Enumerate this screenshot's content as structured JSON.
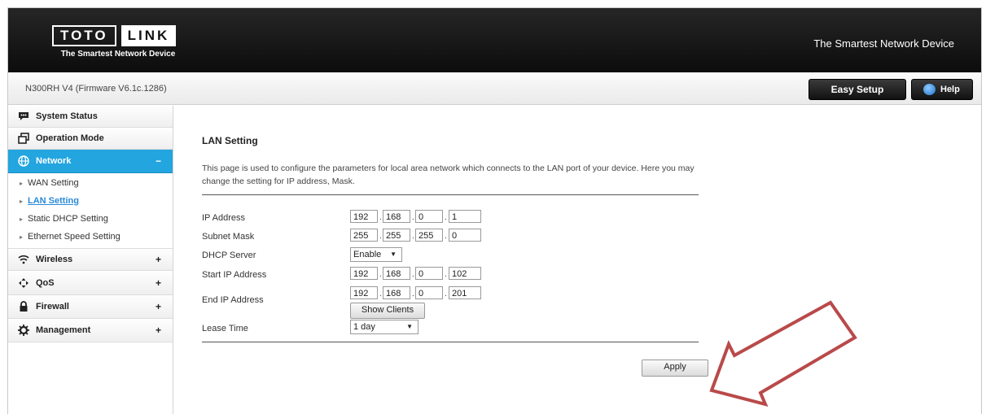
{
  "header": {
    "logo_word1": "TOTO",
    "logo_word2": "LINK",
    "logo_tagline": "The Smartest Network Device",
    "slogan": "The Smartest Network Device"
  },
  "subheader": {
    "model": "N300RH V4 (Firmware V6.1c.1286)",
    "easy_setup": "Easy Setup",
    "help": "Help"
  },
  "sidebar": {
    "items": [
      {
        "label": "System Status",
        "icon": "chat-icon"
      },
      {
        "label": "Operation Mode",
        "icon": "window-icon"
      },
      {
        "label": "Network",
        "icon": "globe-icon",
        "toggle": "−"
      },
      {
        "label": "Wireless",
        "icon": "wifi-icon",
        "toggle": "+"
      },
      {
        "label": "QoS",
        "icon": "qos-icon",
        "toggle": "+"
      },
      {
        "label": "Firewall",
        "icon": "lock-icon",
        "toggle": "+"
      },
      {
        "label": "Management",
        "icon": "gear-icon",
        "toggle": "+"
      }
    ],
    "network_sub": [
      "WAN Setting",
      "LAN Setting",
      "Static DHCP Setting",
      "Ethernet Speed Setting"
    ],
    "bullet": "▸"
  },
  "main": {
    "title": "LAN Setting",
    "description": "This page is used to configure the parameters for local area network which connects to the LAN port of your device. Here you may change the setting for IP address, Mask.",
    "fields": {
      "ip_label": "IP Address",
      "ip": [
        "192",
        "168",
        "0",
        "1"
      ],
      "mask_label": "Subnet Mask",
      "mask": [
        "255",
        "255",
        "255",
        "0"
      ],
      "dhcp_label": "DHCP Server",
      "dhcp_value": "Enable",
      "start_label": "Start IP Address",
      "start": [
        "192",
        "168",
        "0",
        "102"
      ],
      "end_label": "End IP Address",
      "end": [
        "192",
        "168",
        "0",
        "201"
      ],
      "show_clients": "Show Clients",
      "lease_label": "Lease Time",
      "lease_value": "1 day"
    },
    "apply": "Apply",
    "dot": ".",
    "arrow_glyph": "▼"
  },
  "colors": {
    "accent": "#23a5df",
    "annotation_arrow": "#b94a4a"
  }
}
